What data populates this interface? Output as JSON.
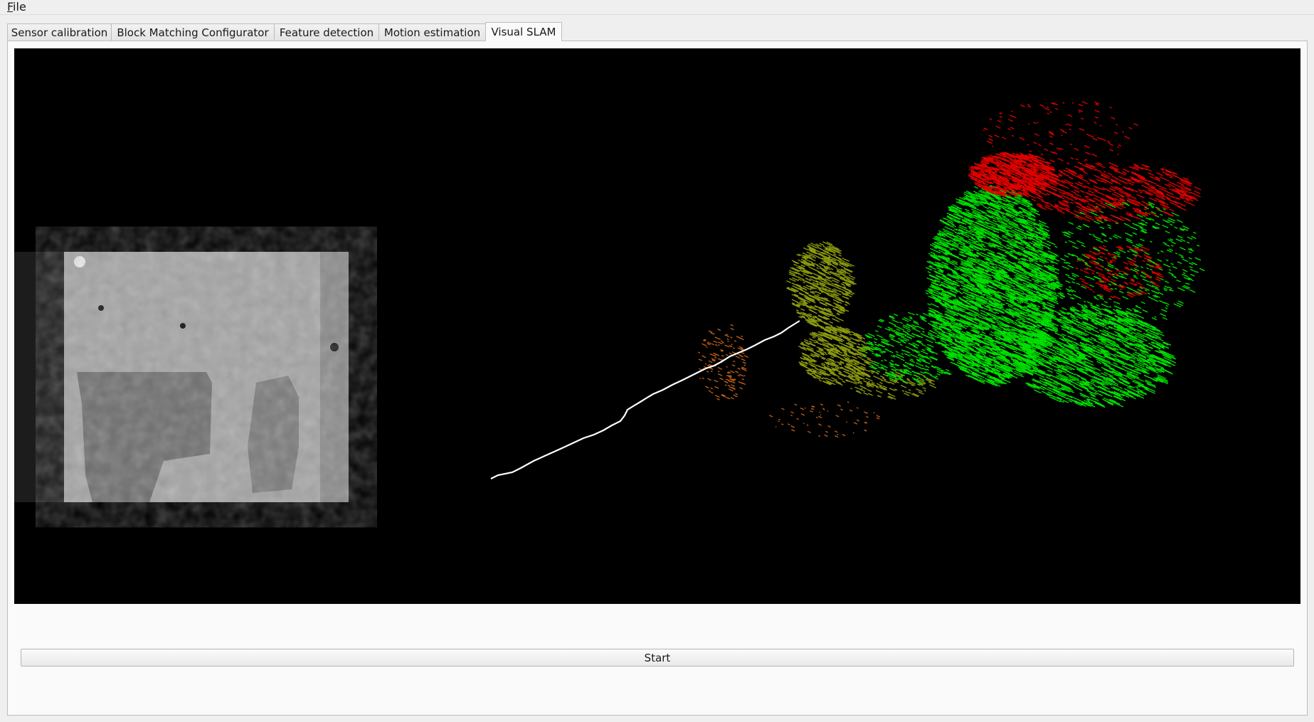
{
  "menubar": {
    "file_mnemonic": "F",
    "file_rest": "ile"
  },
  "tabs": [
    {
      "label": "Sensor calibration",
      "active": false
    },
    {
      "label": "Block Matching Configurator",
      "active": false
    },
    {
      "label": "Feature detection",
      "active": false
    },
    {
      "label": "Motion estimation",
      "active": false
    },
    {
      "label": "Visual SLAM",
      "active": true
    }
  ],
  "visualization": {
    "background": "#000000",
    "trajectory_color": "#ffffff",
    "point_colors": {
      "near": "#00e000",
      "far": "#e00000",
      "mid": "#8c9a10",
      "low": "#c0601a"
    }
  },
  "actions": {
    "start_label": "Start"
  }
}
